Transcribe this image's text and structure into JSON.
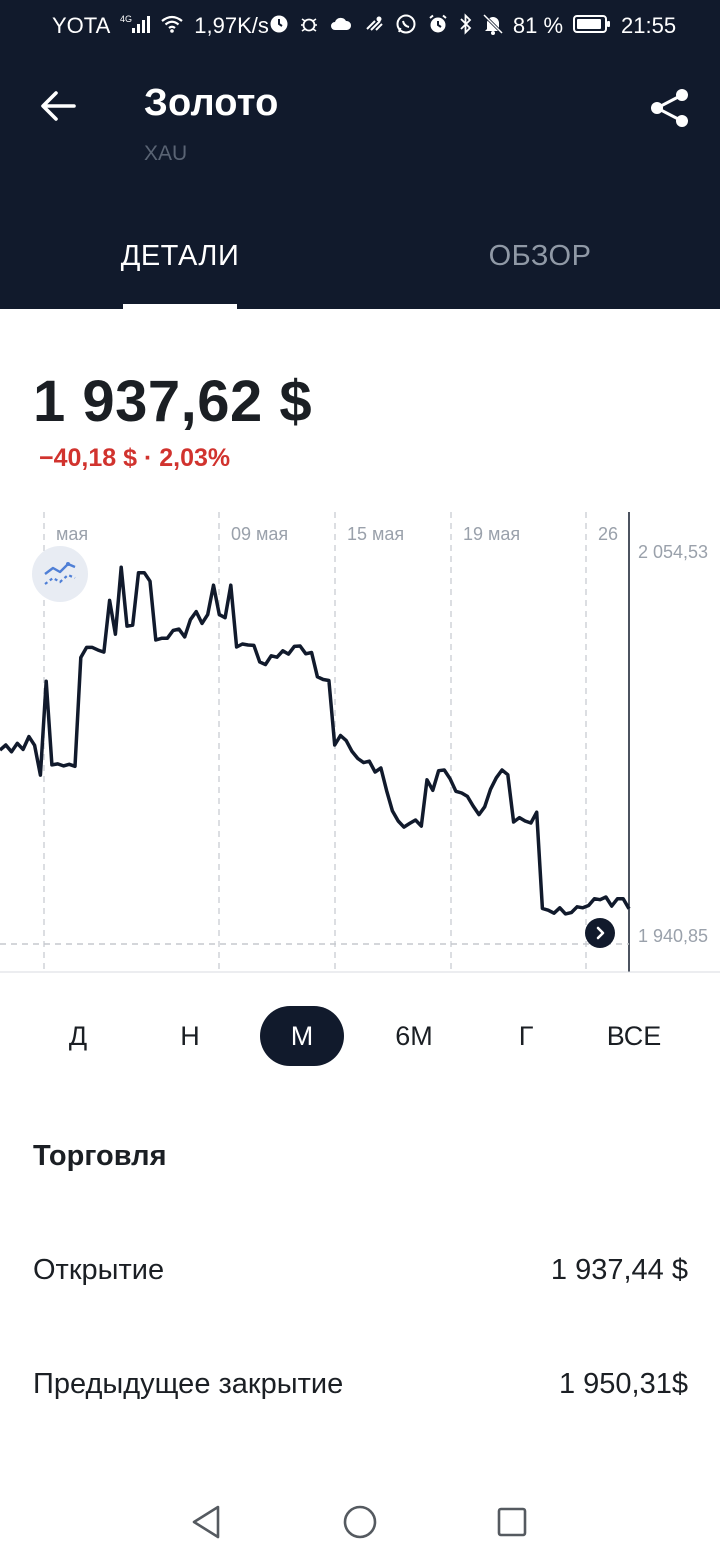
{
  "status_bar": {
    "carrier": "YOTA",
    "network": "4G",
    "speed": "1,97K/s",
    "battery": "81 %",
    "time": "21:55",
    "icons": [
      "signal-icon",
      "wifi-icon",
      "timer-icon",
      "bug-icon",
      "cloud-icon",
      "weather-icon",
      "whatsapp-icon",
      "alarm-icon",
      "bluetooth-icon",
      "mute-icon",
      "battery-icon"
    ]
  },
  "header": {
    "title": "Золото",
    "subtitle": "XAU",
    "tabs": [
      {
        "label": "ДЕТАЛИ",
        "active": true
      },
      {
        "label": "ОБЗОР",
        "active": false
      }
    ]
  },
  "quote": {
    "price": "1 937,62 $",
    "change": "−40,18 $ · 2,03%",
    "change_color": "#d1332e"
  },
  "chart_data": {
    "type": "line",
    "x_tick_labels": [
      "мая",
      "09 мая",
      "15 мая",
      "19 мая",
      "26"
    ],
    "y_tick_labels": [
      "2 054,53",
      "1 940,85"
    ],
    "ylim": [
      1940.85,
      2054.53
    ],
    "grid": true,
    "series": [
      {
        "values": [
          1995.3,
          1996.8,
          1994.8,
          1997.3,
          1995.5,
          1999.3,
          1996.7,
          1987.9,
          2015.7,
          1990.9,
          1991.2,
          1990.6,
          1991.1,
          1990.5,
          2022.7,
          2025.7,
          2025.7,
          2024.9,
          2024.3,
          2039.6,
          2029.6,
          2049.4,
          2032.0,
          2032.3,
          2047.8,
          2047.8,
          2045.3,
          2027.9,
          2028.4,
          2028.4,
          2030.7,
          2031.1,
          2028.8,
          2033.9,
          2036.3,
          2032.8,
          2035.4,
          2044.1,
          2035.4,
          2034.5,
          2044.1,
          2025.8,
          2026.7,
          2026.4,
          2026.3,
          2021.4,
          2020.6,
          2023.2,
          2022.8,
          2024.7,
          2023.7,
          2026.0,
          2026.1,
          2023.8,
          2024.2,
          2017.0,
          2016.2,
          2015.9,
          1996.8,
          1999.6,
          1998.1,
          1994.9,
          1992.8,
          1991.6,
          1992.0,
          1988.8,
          1990.0,
          1983.3,
          1977.3,
          1974.3,
          1972.5,
          1973.6,
          1974.6,
          1972.8,
          1986.5,
          1983.4,
          1989.2,
          1989.4,
          1986.8,
          1983.1,
          1982.6,
          1981.6,
          1978.7,
          1976.2,
          1978.5,
          1983.7,
          1987.1,
          1989.4,
          1988.0,
          1974.0,
          1975.3,
          1974.3,
          1973.7,
          1976.9,
          1948.4,
          1947.9,
          1947.0,
          1948.6,
          1946.8,
          1947.2,
          1948.9,
          1948.6,
          1949.3,
          1951.3,
          1951.0,
          1951.8,
          1949.1,
          1951.3,
          1951.3,
          1948.3
        ]
      }
    ],
    "line_color": "#111a2c"
  },
  "ranges": [
    {
      "label": "Д",
      "active": false
    },
    {
      "label": "Н",
      "active": false
    },
    {
      "label": "М",
      "active": true
    },
    {
      "label": "6М",
      "active": false
    },
    {
      "label": "Г",
      "active": false
    },
    {
      "label": "ВСЕ",
      "active": false
    }
  ],
  "trading": {
    "section_title": "Торговля",
    "rows": [
      {
        "label": "Открытие",
        "value": "1 937,44 $"
      },
      {
        "label": "Предыдущее закрытие",
        "value": "1 950,31$"
      }
    ]
  },
  "nav": {
    "buttons": [
      "back-nav-icon",
      "home-nav-icon",
      "recents-nav-icon"
    ]
  }
}
